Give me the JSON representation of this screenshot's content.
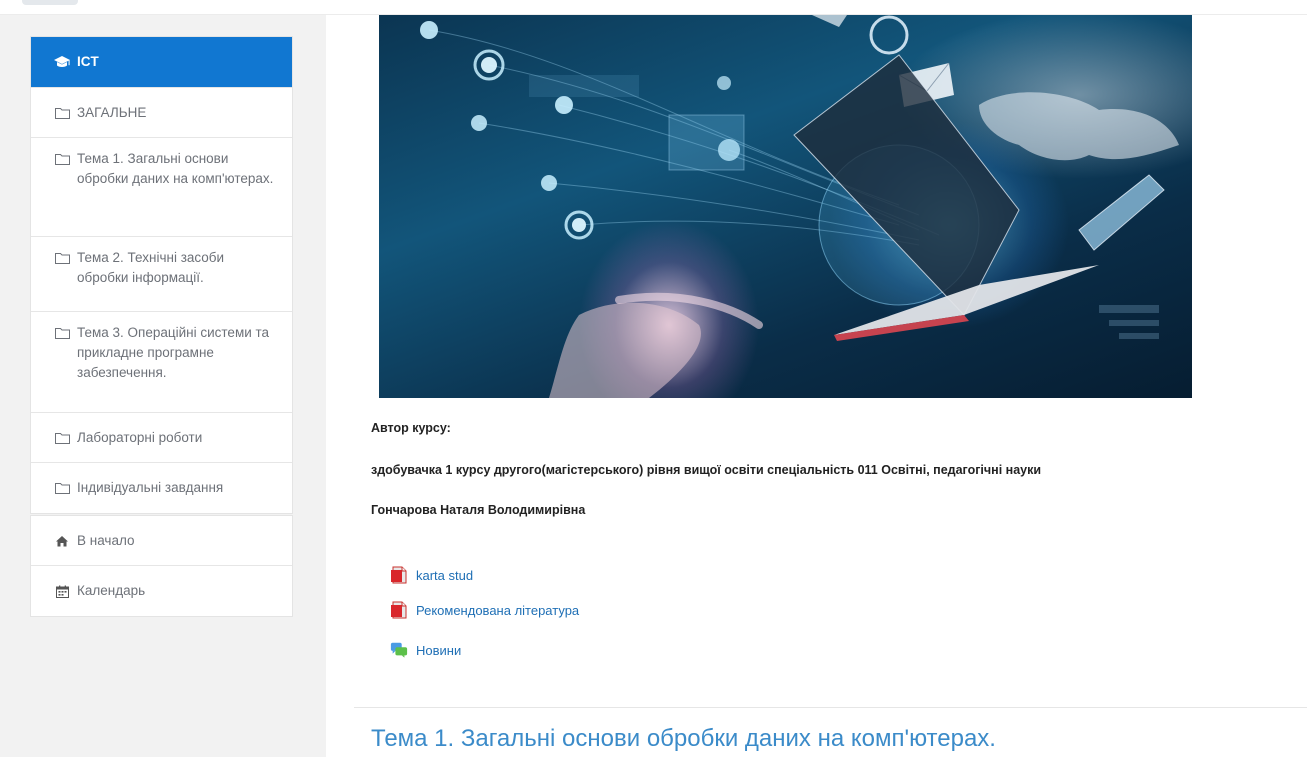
{
  "nav": {
    "course": {
      "label": "ICT",
      "icon": "graduation-cap-icon"
    },
    "sections": [
      {
        "label": "ЗАГАЛЬНЕ",
        "icon": "folder-icon"
      },
      {
        "label": "Тема 1. Загальні основи обробки даних на комп'ютерах.",
        "icon": "folder-icon"
      },
      {
        "label": "Тема 2. Технічні засоби обробки інформації.",
        "icon": "folder-icon"
      },
      {
        "label": "Тема 3. Операційні системи та прикладне програмне забезпечення.",
        "icon": "folder-icon"
      },
      {
        "label": "Лабораторні роботи",
        "icon": "folder-icon"
      },
      {
        "label": "Індивідуальні завдання",
        "icon": "folder-icon"
      }
    ],
    "links": [
      {
        "label": "В начало",
        "icon": "home-icon"
      },
      {
        "label": "Календарь",
        "icon": "calendar-icon"
      }
    ]
  },
  "content": {
    "author_label": "Автор курсу:",
    "author_desc": "здобувачка 1 курсу другого(магістерського) рівня вищої освіти спеціальність 011 Освітні, педагогічні науки",
    "author_name": "Гончарова Наталя Володимирівна",
    "activities": [
      {
        "label": "karta stud",
        "icon": "pdf-file-icon"
      },
      {
        "label": "Рекомендована література",
        "icon": "pdf-file-icon"
      },
      {
        "label": "Новини",
        "icon": "forum-icon"
      }
    ],
    "next_section_title": "Тема 1. Загальні основи обробки даних на комп'ютерах."
  },
  "colors": {
    "accent": "#1177d1",
    "link": "#1f6fb5",
    "section_title": "#3b8bc9",
    "drawer_bg": "#f2f2f2"
  }
}
